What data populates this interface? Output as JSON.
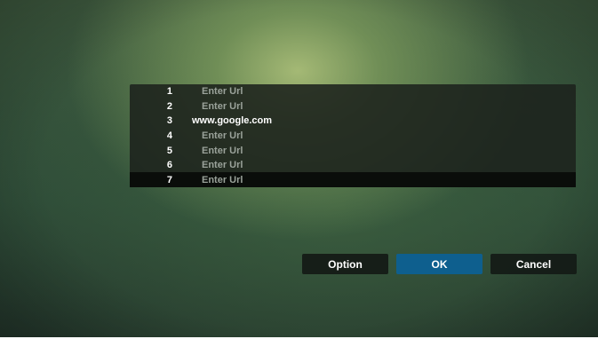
{
  "url_list": {
    "rows": [
      {
        "number": "1",
        "value": "Enter Url"
      },
      {
        "number": "2",
        "value": "Enter Url"
      },
      {
        "number": "3",
        "value": "www.google.com"
      },
      {
        "number": "4",
        "value": "Enter Url"
      },
      {
        "number": "5",
        "value": "Enter Url"
      },
      {
        "number": "6",
        "value": "Enter Url"
      },
      {
        "number": "7",
        "value": "Enter Url"
      }
    ],
    "selected_row": "7"
  },
  "buttons": {
    "option_label": "Option",
    "ok_label": "OK",
    "cancel_label": "Cancel"
  },
  "colors": {
    "ok_accent": "#0e5f8e",
    "panel_bg": "#1c221c",
    "placeholder_text": "#9aa29a"
  }
}
